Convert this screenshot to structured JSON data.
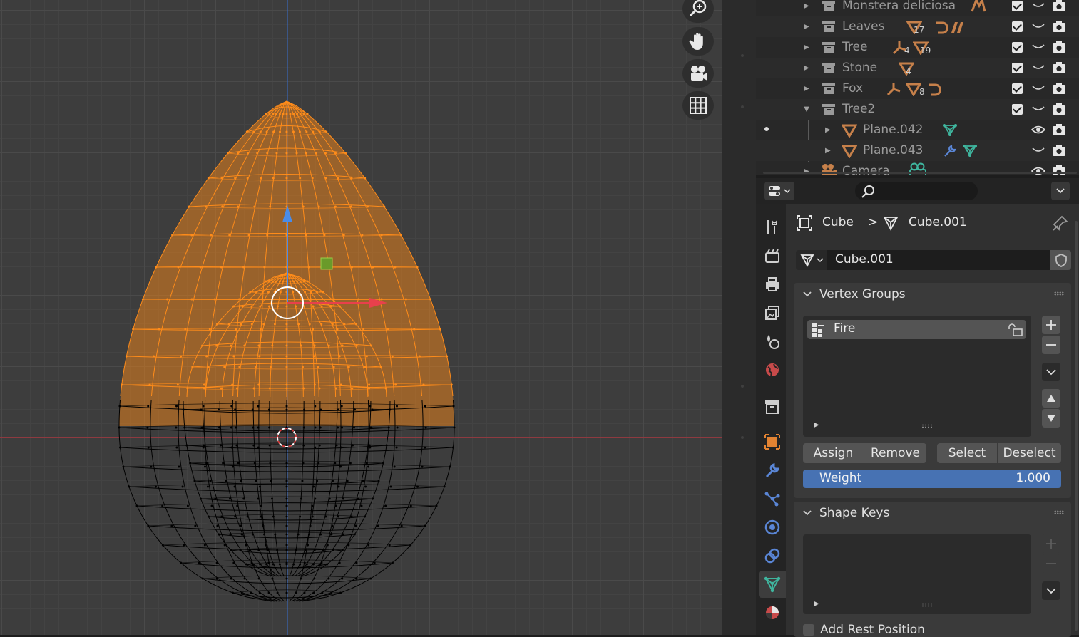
{
  "outliner": {
    "rows": [
      {
        "label": "Monstera deliciosa",
        "expanded": false
      },
      {
        "label": "Leaves",
        "expanded": false,
        "counts": [
          "17"
        ]
      },
      {
        "label": "Tree",
        "expanded": false,
        "counts": [
          "4",
          "19"
        ]
      },
      {
        "label": "Stone",
        "expanded": false,
        "counts": [
          "4"
        ]
      },
      {
        "label": "Fox",
        "expanded": false,
        "counts": [
          "8"
        ]
      },
      {
        "label": "Tree2",
        "expanded": true
      },
      {
        "label": "Plane.042",
        "expanded": false
      },
      {
        "label": "Plane.043",
        "expanded": false
      },
      {
        "label": "Camera",
        "expanded": false
      }
    ]
  },
  "viewport": {
    "nav_icons": [
      "zoom-icon",
      "hand-pan-icon",
      "camera-view-icon",
      "grid-ortho-icon"
    ],
    "colors": {
      "selected_mesh": "#ff8c1a",
      "unselected_mesh": "#000000",
      "x_axis": "#c4323d",
      "z_axis": "#2c5fb3"
    }
  },
  "properties": {
    "breadcrumb": {
      "object": "Cube",
      "separator": ">",
      "mesh": "Cube.001"
    },
    "datablock_name": "Cube.001",
    "vertex_groups": {
      "title": "Vertex Groups",
      "items": [
        {
          "name": "Fire"
        }
      ],
      "buttons": {
        "assign": "Assign",
        "remove": "Remove",
        "select": "Select",
        "deselect": "Deselect"
      },
      "weight_label": "Weight",
      "weight_value": "1.000"
    },
    "shape_keys": {
      "title": "Shape Keys"
    },
    "add_rest_position": "Add Rest Position",
    "accent_color": "#4772b3"
  }
}
